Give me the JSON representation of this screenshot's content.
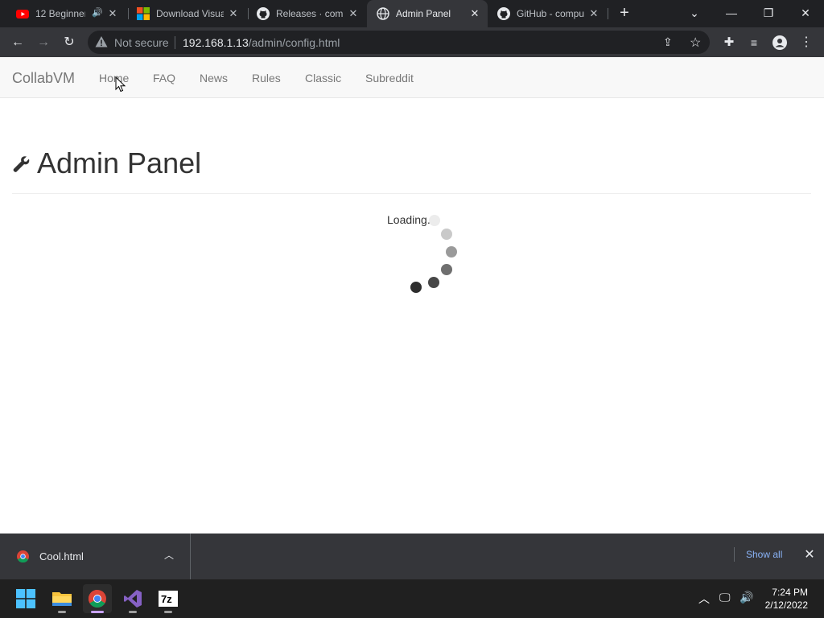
{
  "browser": {
    "tabs": [
      {
        "title": "12 Beginner",
        "icon": "youtube-icon",
        "audio": true,
        "active": false
      },
      {
        "title": "Download Visua",
        "icon": "microsoft-icon",
        "active": false
      },
      {
        "title": "Releases · comp",
        "icon": "github-icon",
        "active": false
      },
      {
        "title": "Admin Panel",
        "icon": "globe-icon",
        "active": true
      },
      {
        "title": "GitHub - compu",
        "icon": "github-icon",
        "active": false
      }
    ],
    "new_tab": "+",
    "omnibox": {
      "security_label": "Not secure",
      "url_host": "192.168.1.13",
      "url_path": "/admin/config.html"
    }
  },
  "page": {
    "brand": "CollabVM",
    "nav": [
      "Home",
      "FAQ",
      "News",
      "Rules",
      "Classic",
      "Subreddit"
    ],
    "title": "Admin Panel",
    "loading_text": "Loading..."
  },
  "downloads": {
    "file": "Cool.html",
    "show_all": "Show all"
  },
  "taskbar": {
    "apps": [
      "windows-start-icon",
      "file-explorer-icon",
      "chrome-icon",
      "visual-studio-icon",
      "7zip-icon"
    ],
    "time": "7:24 PM",
    "date": "2/12/2022"
  },
  "colors": {
    "tab_strip": "#202124",
    "toolbar": "#35363a",
    "link_blue": "#8ab4f8",
    "navbar": "#f8f8f8"
  }
}
